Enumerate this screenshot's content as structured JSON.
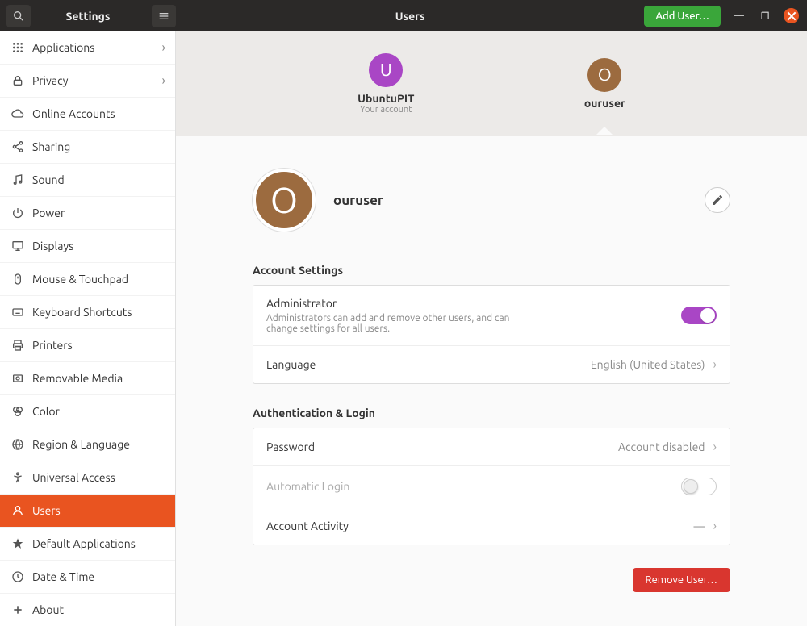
{
  "header": {
    "settings_title": "Settings",
    "panel_title": "Users",
    "add_user_label": "Add User…"
  },
  "sidebar": {
    "items": [
      {
        "label": "Applications",
        "icon": "grid",
        "chevron": true
      },
      {
        "label": "Privacy",
        "icon": "lock",
        "chevron": true
      },
      {
        "label": "Online Accounts",
        "icon": "cloud"
      },
      {
        "label": "Sharing",
        "icon": "share"
      },
      {
        "label": "Sound",
        "icon": "music"
      },
      {
        "label": "Power",
        "icon": "power"
      },
      {
        "label": "Displays",
        "icon": "display"
      },
      {
        "label": "Mouse & Touchpad",
        "icon": "mouse"
      },
      {
        "label": "Keyboard Shortcuts",
        "icon": "keyboard"
      },
      {
        "label": "Printers",
        "icon": "printer"
      },
      {
        "label": "Removable Media",
        "icon": "media"
      },
      {
        "label": "Color",
        "icon": "color"
      },
      {
        "label": "Region & Language",
        "icon": "globe"
      },
      {
        "label": "Universal Access",
        "icon": "accessibility"
      },
      {
        "label": "Users",
        "icon": "user",
        "active": true
      },
      {
        "label": "Default Applications",
        "icon": "star"
      },
      {
        "label": "Date & Time",
        "icon": "clock"
      },
      {
        "label": "About",
        "icon": "plus"
      }
    ]
  },
  "users_switcher": [
    {
      "name": "UbuntuPIT",
      "initial": "U",
      "sub": "Your account",
      "color": "purple"
    },
    {
      "name": "ouruser",
      "initial": "O",
      "color": "brown",
      "selected": true
    }
  ],
  "profile": {
    "name": "ouruser",
    "initial": "O"
  },
  "sections": {
    "account": {
      "title": "Account Settings",
      "admin_label": "Administrator",
      "admin_desc": "Administrators can add and remove other users, and can change settings for all users.",
      "admin_on": true,
      "language_label": "Language",
      "language_value": "English (United States)"
    },
    "auth": {
      "title": "Authentication & Login",
      "password_label": "Password",
      "password_value": "Account disabled",
      "autologin_label": "Automatic Login",
      "autologin_on": false,
      "activity_label": "Account Activity",
      "activity_value": "—"
    }
  },
  "remove_label": "Remove User…"
}
